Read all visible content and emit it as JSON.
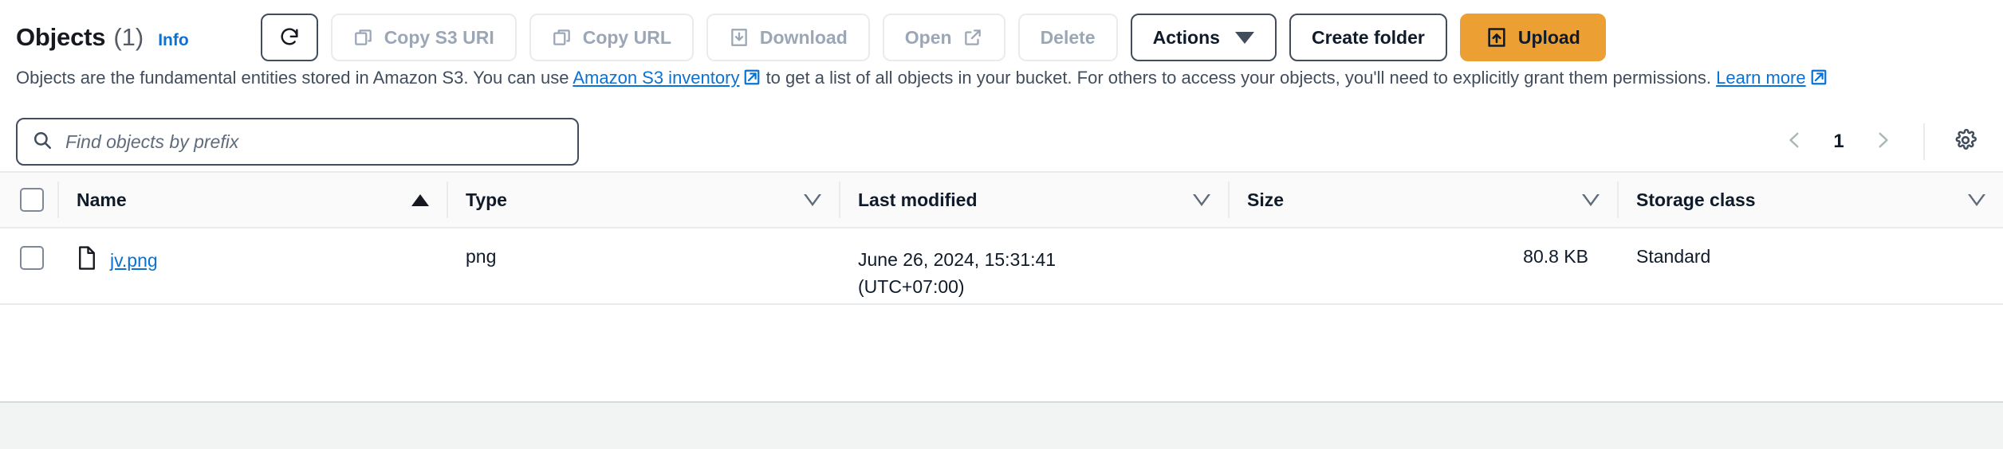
{
  "header": {
    "title": "Objects",
    "count": "(1)",
    "info_label": "Info"
  },
  "toolbar": {
    "refresh_icon": "refresh-icon",
    "buttons": [
      {
        "label": "Copy S3 URI",
        "icon": "copy-icon",
        "state": "disabled"
      },
      {
        "label": "Copy URL",
        "icon": "copy-icon",
        "state": "disabled"
      },
      {
        "label": "Download",
        "icon": "download-icon",
        "state": "disabled"
      },
      {
        "label": "Open",
        "icon": "external-link-icon",
        "state": "disabled"
      },
      {
        "label": "Delete",
        "icon": "",
        "state": "disabled"
      },
      {
        "label": "Actions",
        "icon": "chevron-down-icon",
        "state": "enabled"
      },
      {
        "label": "Create folder",
        "icon": "",
        "state": "enabled"
      },
      {
        "label": "Upload",
        "icon": "upload-icon",
        "state": "primary"
      }
    ]
  },
  "description": {
    "part1": "Objects are the fundamental entities stored in Amazon S3. You can use ",
    "link1": "Amazon S3 inventory",
    "part2": " to get a list of all objects in your bucket. For others to access your objects, you'll need to explicitly grant them permissions. ",
    "link2": "Learn more"
  },
  "search": {
    "placeholder": "Find objects by prefix",
    "value": "",
    "icon": "search-icon"
  },
  "pagination": {
    "prev_icon": "chevron-left-icon",
    "page": "1",
    "next_icon": "chevron-right-icon",
    "settings_icon": "gear-icon"
  },
  "table": {
    "columns": [
      {
        "label": "Name",
        "sort": "asc"
      },
      {
        "label": "Type",
        "sort": "none"
      },
      {
        "label": "Last modified",
        "sort": "none"
      },
      {
        "label": "Size",
        "sort": "none"
      },
      {
        "label": "Storage class",
        "sort": "none"
      }
    ],
    "rows": [
      {
        "name": "jv.png",
        "type": "png",
        "last_modified_date": "June 26, 2024, 15:31:41",
        "last_modified_tz": "(UTC+07:00)",
        "size": "80.8 KB",
        "storage_class": "Standard",
        "file_icon": "file-icon"
      }
    ]
  },
  "colors": {
    "link": "#0972d3",
    "primary_button": "#ec9f33",
    "border": "#e9ebed",
    "text": "#0f1b2a",
    "muted": "#5f6b7a"
  }
}
